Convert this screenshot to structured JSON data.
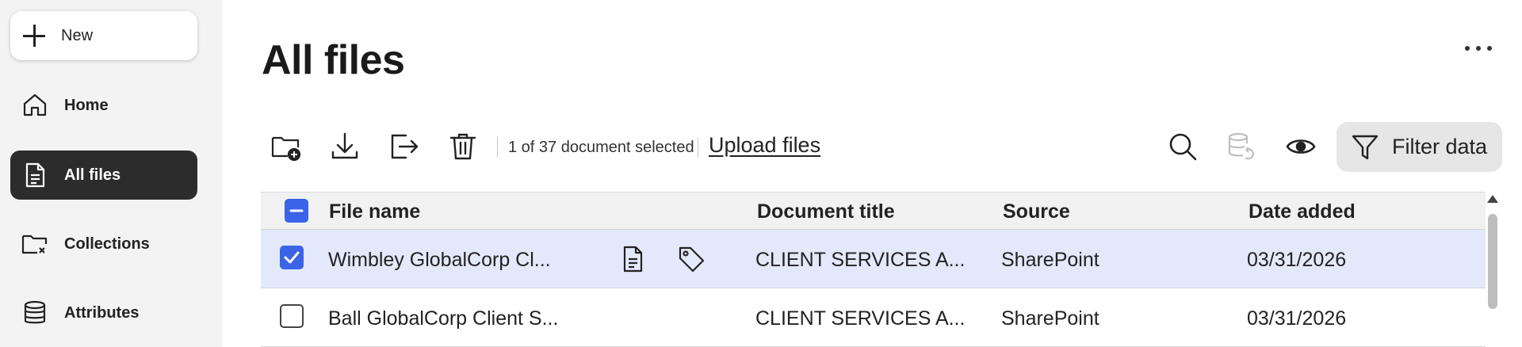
{
  "sidebar": {
    "new_label": "New",
    "items": [
      {
        "label": "Home",
        "icon": "home-icon"
      },
      {
        "label": "All files",
        "icon": "document-icon",
        "active": true
      },
      {
        "label": "Collections",
        "icon": "folder-icon"
      },
      {
        "label": "Attributes",
        "icon": "database-icon"
      }
    ]
  },
  "page": {
    "title": "All files"
  },
  "toolbar": {
    "selection_text": "1 of 37 document selected",
    "upload_label": "Upload files",
    "filter_label": "Filter data",
    "icons": [
      "new-folder-icon",
      "download-icon",
      "export-icon",
      "delete-icon",
      "search-icon",
      "sync-database-icon",
      "eye-icon",
      "filter-icon"
    ]
  },
  "table": {
    "columns": [
      "File name",
      "Document title",
      "Source",
      "Date added"
    ],
    "rows": [
      {
        "file_name": "Wimbley GlobalCorp Cl...",
        "title": "CLIENT SERVICES A...",
        "source": "SharePoint",
        "date": "03/31/2026",
        "selected": true
      },
      {
        "file_name": "Ball GlobalCorp Client S...",
        "title": "CLIENT SERVICES A...",
        "source": "SharePoint",
        "date": "03/31/2026",
        "selected": false
      }
    ]
  },
  "colors": {
    "accent": "#3b63e8",
    "selected_row": "#e3e9fb",
    "active_nav": "#2c2c2c"
  }
}
